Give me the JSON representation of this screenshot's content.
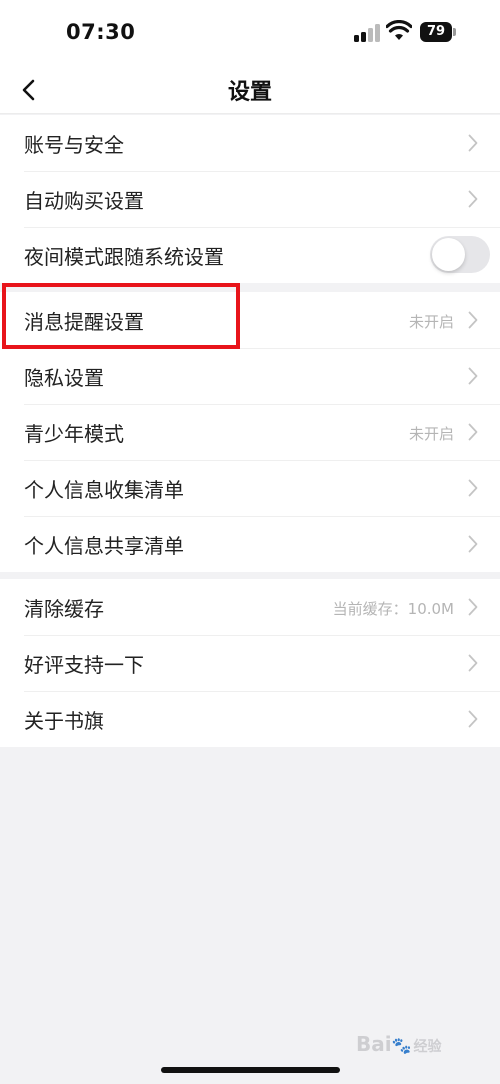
{
  "status_bar": {
    "time": "07:30",
    "battery": "79"
  },
  "nav": {
    "title": "设置"
  },
  "groups": [
    {
      "items": [
        {
          "label": "账号与安全"
        },
        {
          "label": "自动购买设置"
        },
        {
          "label": "夜间模式跟随系统设置",
          "toggle": false
        }
      ]
    },
    {
      "items": [
        {
          "label": "消息提醒设置",
          "value": "未开启"
        },
        {
          "label": "隐私设置"
        },
        {
          "label": "青少年模式",
          "value": "未开启"
        },
        {
          "label": "个人信息收集清单"
        },
        {
          "label": "个人信息共享清单"
        }
      ]
    },
    {
      "items": [
        {
          "label": "清除缓存",
          "value": "当前缓存：10.0M"
        },
        {
          "label": "好评支持一下"
        },
        {
          "label": "关于书旗"
        }
      ]
    }
  ],
  "colors": {
    "highlight": "#e8141a",
    "background": "#f2f2f4",
    "toggle_off": "#e6e6e9"
  },
  "watermark": {
    "text": "Bai",
    "suffix": "经验"
  }
}
